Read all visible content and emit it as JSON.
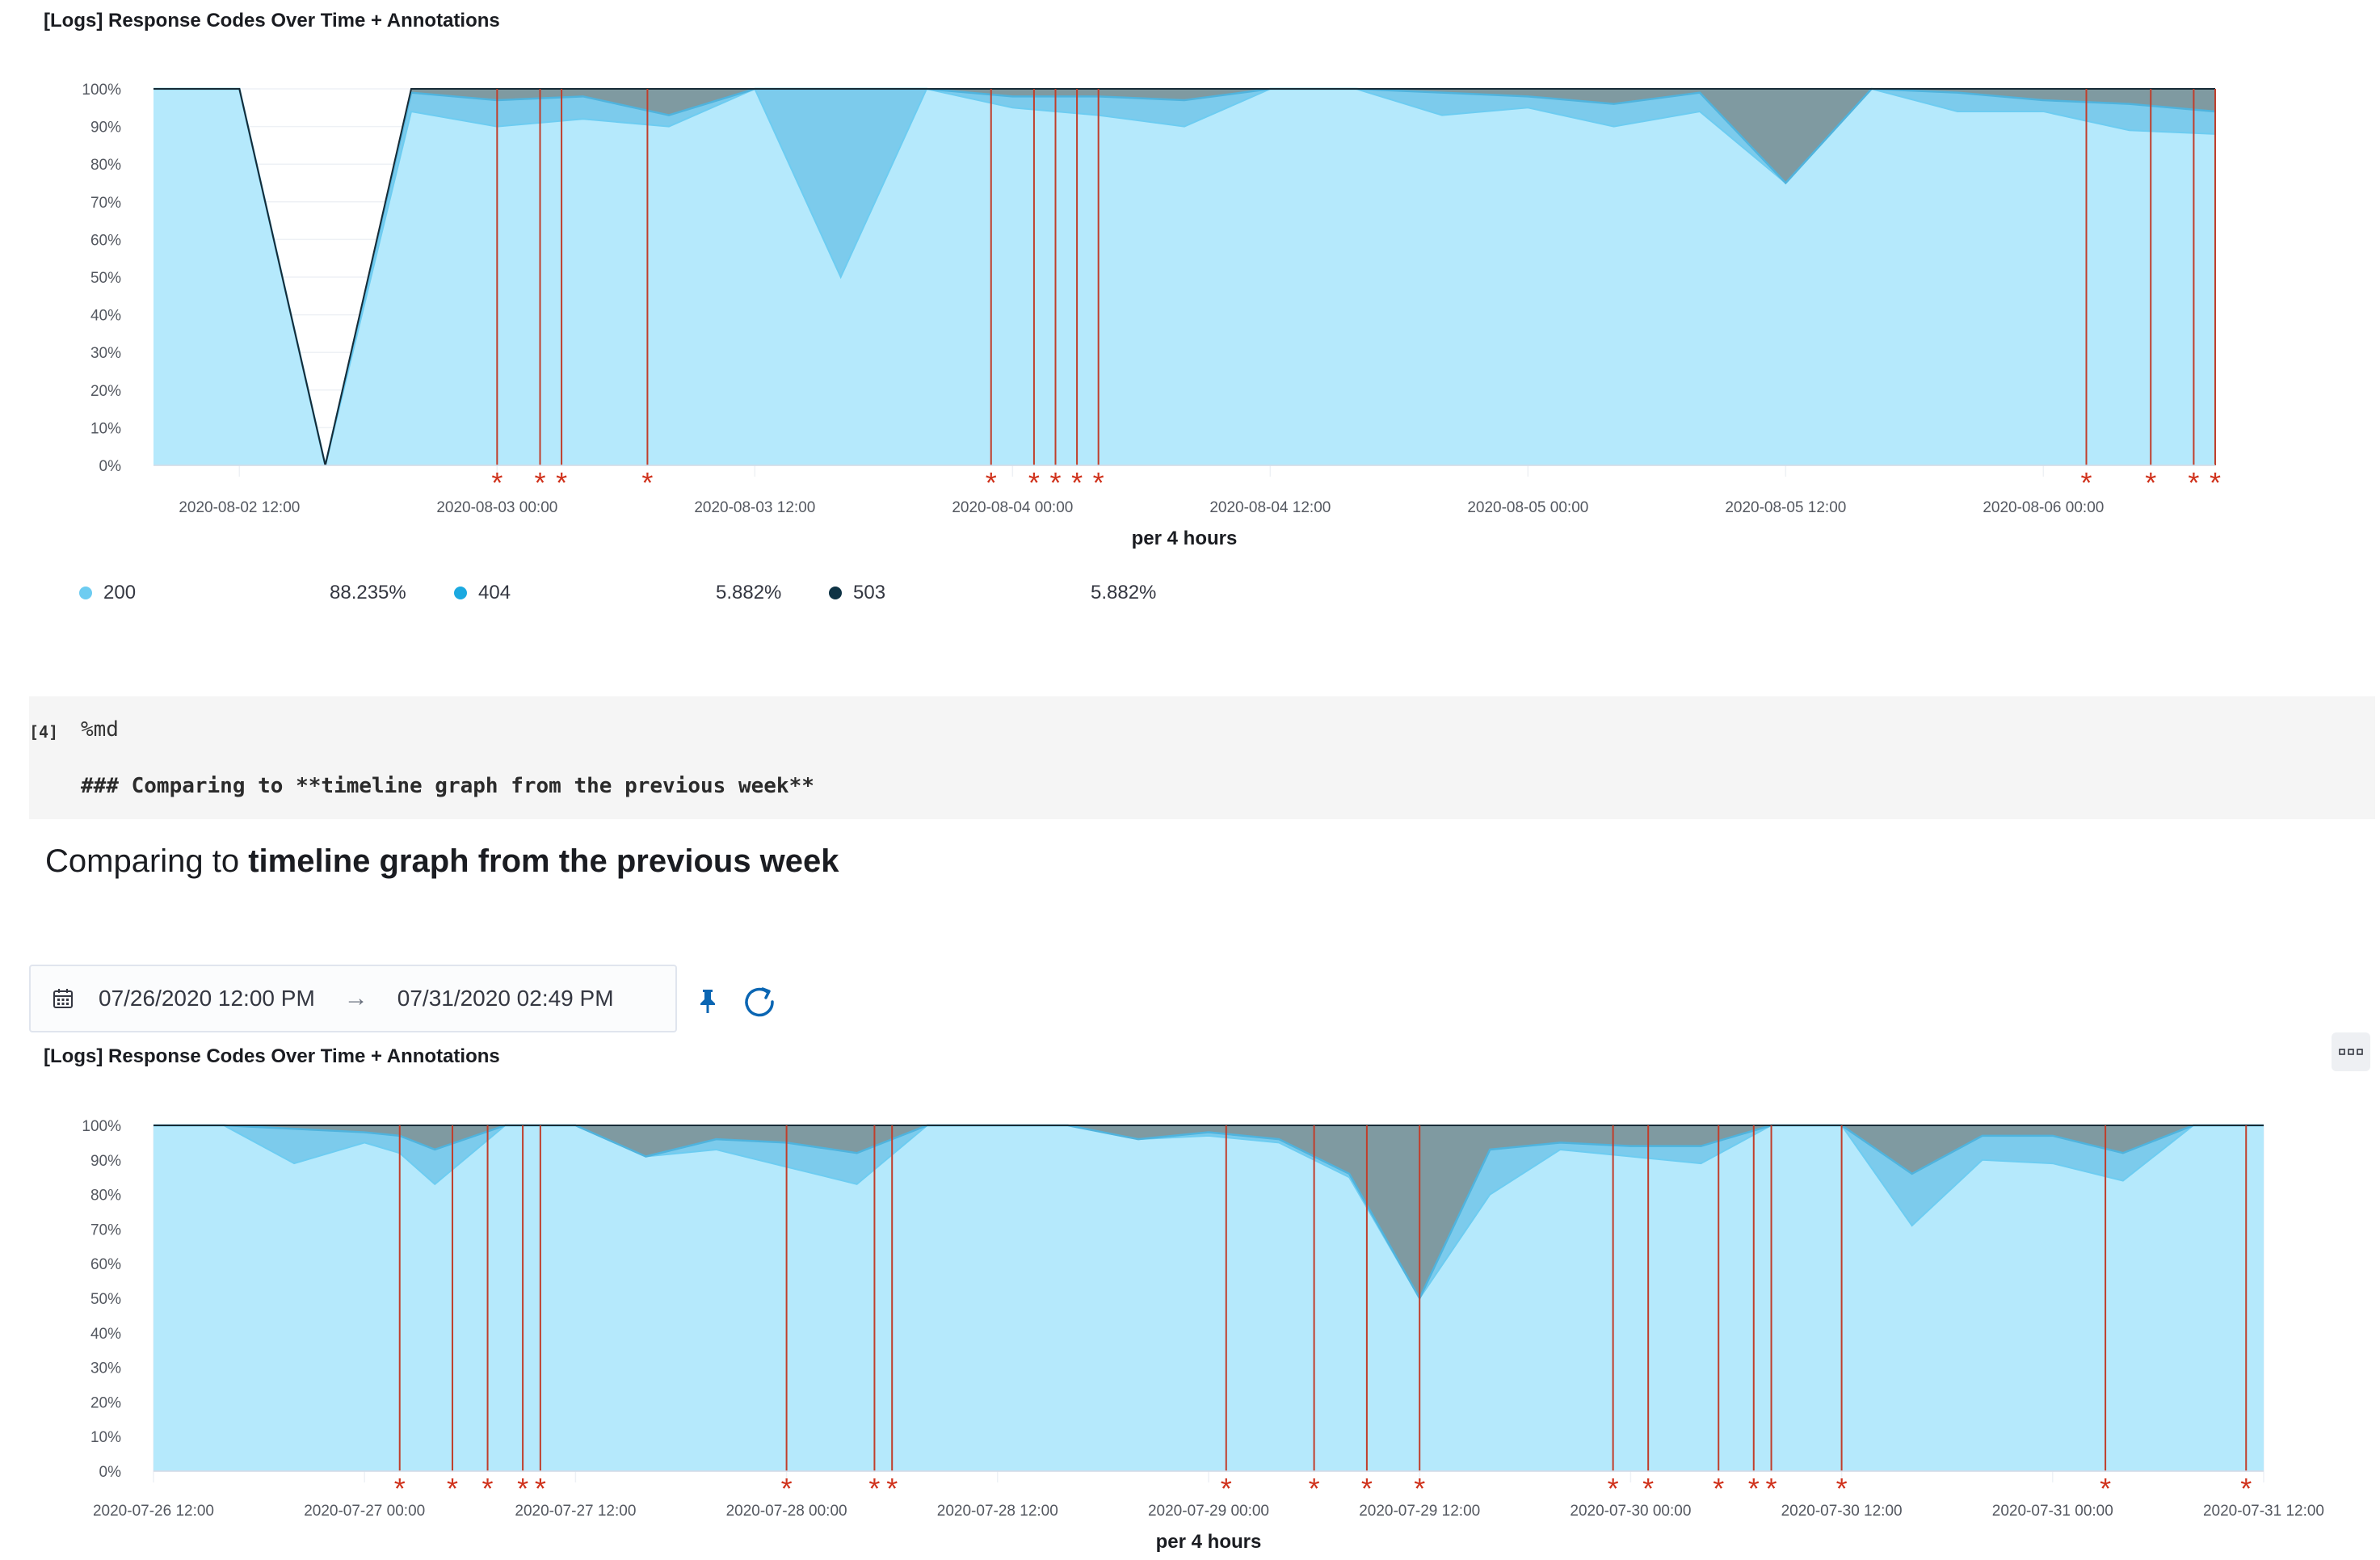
{
  "top_chart": {
    "title": "[Logs] Response Codes Over Time + Annotations",
    "xlabel": "per 4 hours",
    "legend": [
      {
        "label": "200",
        "percent": "88.235%",
        "color": "#6dccf1"
      },
      {
        "label": "404",
        "percent": "5.882%",
        "color": "#1ba9e0"
      },
      {
        "label": "503",
        "percent": "5.882%",
        "color": "#0e3345"
      }
    ]
  },
  "cell": {
    "prompt": "[4]",
    "magic": "%md",
    "source": "### Comparing to **timeline graph from the previous week**"
  },
  "markdown": {
    "heading_plain": "Comparing to ",
    "heading_bold": "timeline graph from the previous week"
  },
  "date_range": {
    "start": "07/26/2020 12:00 PM",
    "arrow": "→",
    "end": "07/31/2020 02:49 PM"
  },
  "bottom_chart": {
    "title": "[Logs] Response Codes Over Time + Annotations",
    "xlabel": "per 4 hours"
  },
  "colors": {
    "series_200": "#b5e9fc",
    "series_200_line": "#6dccf1",
    "series_404": "#7ccbec",
    "series_404_line": "#4fb3dd",
    "series_503": "#7f9aa1",
    "series_503_line": "#1f5b80",
    "annotation": "#c03e2b"
  },
  "chart_data": [
    {
      "type": "area",
      "title": "[Logs] Response Codes Over Time + Annotations",
      "xlabel": "per 4 hours",
      "ylabel": "",
      "ylim": [
        0,
        100
      ],
      "y_ticks": [
        "0%",
        "10%",
        "20%",
        "30%",
        "40%",
        "50%",
        "60%",
        "70%",
        "80%",
        "90%",
        "100%"
      ],
      "x_ticks": [
        "2020-08-02 12:00",
        "2020-08-03 00:00",
        "2020-08-03 12:00",
        "2020-08-04 00:00",
        "2020-08-04 12:00",
        "2020-08-05 00:00",
        "2020-08-05 12:00",
        "2020-08-06 00:00"
      ],
      "x_tick_hours": [
        0,
        12,
        24,
        36,
        48,
        60,
        72,
        84
      ],
      "x_range_hours": [
        -4,
        92
      ],
      "x_hours": [
        -4,
        0,
        4,
        8,
        12,
        16,
        20,
        24,
        28,
        32,
        36,
        40,
        44,
        48,
        52,
        56,
        60,
        64,
        68,
        72,
        76,
        80,
        84,
        88,
        92
      ],
      "series": [
        {
          "name": "200",
          "values": [
            100,
            100,
            0,
            94,
            90,
            92,
            90,
            100,
            50,
            100,
            95,
            93,
            90,
            100,
            100,
            93,
            95,
            90,
            94,
            75,
            100,
            94,
            94,
            89,
            88
          ]
        },
        {
          "name": "404",
          "values": [
            0,
            0,
            0,
            5,
            7,
            6,
            3,
            0,
            50,
            0,
            3,
            5,
            7,
            0,
            0,
            6,
            3,
            6,
            5,
            0,
            0,
            5,
            3,
            7,
            6
          ]
        },
        {
          "name": "503",
          "values": [
            0,
            0,
            0,
            1,
            3,
            2,
            7,
            0,
            0,
            0,
            2,
            2,
            3,
            0,
            0,
            1,
            2,
            4,
            1,
            25,
            0,
            1,
            3,
            4,
            6
          ]
        }
      ],
      "annotation_hours": [
        12,
        14,
        15,
        19,
        35,
        37,
        38,
        39,
        40,
        86,
        89,
        91,
        92
      ]
    },
    {
      "type": "area",
      "title": "[Logs] Response Codes Over Time + Annotations",
      "xlabel": "per 4 hours",
      "ylabel": "",
      "ylim": [
        0,
        100
      ],
      "y_ticks": [
        "0%",
        "10%",
        "20%",
        "30%",
        "40%",
        "50%",
        "60%",
        "70%",
        "80%",
        "90%",
        "100%"
      ],
      "x_ticks": [
        "2020-07-26 12:00",
        "2020-07-27 00:00",
        "2020-07-27 12:00",
        "2020-07-28 00:00",
        "2020-07-28 12:00",
        "2020-07-29 00:00",
        "2020-07-29 12:00",
        "2020-07-30 00:00",
        "2020-07-30 12:00",
        "2020-07-31 00:00",
        "2020-07-31 12:00"
      ],
      "x_tick_hours": [
        0,
        12,
        24,
        36,
        48,
        60,
        72,
        84,
        96,
        108,
        120
      ],
      "x_range_hours": [
        0,
        120
      ],
      "x_hours": [
        0,
        4,
        8,
        12,
        14,
        16,
        20,
        24,
        28,
        32,
        36,
        40,
        44,
        48,
        52,
        56,
        60,
        64,
        68,
        72,
        76,
        80,
        84,
        88,
        92,
        96,
        100,
        104,
        108,
        112,
        116,
        120
      ],
      "series": [
        {
          "name": "200",
          "values": [
            100,
            100,
            89,
            95,
            92,
            83,
            100,
            100,
            91,
            93,
            88,
            83,
            100,
            100,
            100,
            96,
            97,
            95,
            85,
            50,
            80,
            93,
            91,
            89,
            100,
            100,
            71,
            90,
            89,
            84,
            100,
            100
          ]
        },
        {
          "name": "404",
          "values": [
            0,
            0,
            10,
            3,
            5,
            10,
            0,
            0,
            0,
            3,
            7,
            9,
            0,
            0,
            0,
            0,
            1,
            1,
            1,
            0,
            13,
            2,
            3,
            5,
            0,
            0,
            15,
            7,
            8,
            8,
            0,
            0
          ]
        },
        {
          "name": "503",
          "values": [
            0,
            0,
            1,
            2,
            3,
            7,
            0,
            0,
            9,
            4,
            5,
            8,
            0,
            0,
            0,
            4,
            2,
            4,
            14,
            50,
            7,
            5,
            6,
            6,
            0,
            0,
            14,
            3,
            3,
            8,
            0,
            0
          ]
        }
      ],
      "annotation_hours": [
        14,
        17,
        19,
        21,
        22,
        36,
        41,
        42,
        61,
        66,
        69,
        72,
        83,
        85,
        89,
        91,
        92,
        96,
        111,
        119
      ]
    }
  ]
}
